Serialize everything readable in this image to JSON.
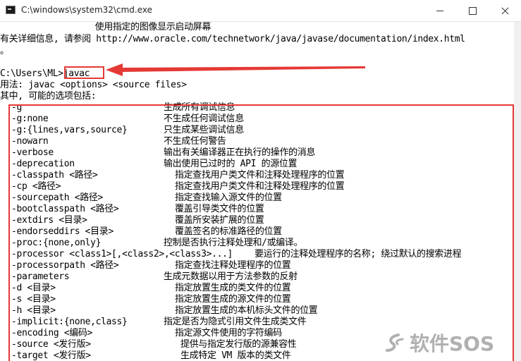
{
  "window": {
    "title": "C:\\windows\\system32\\cmd.exe"
  },
  "console": {
    "top_lines": [
      "                  使用指定的图像显示启动屏幕",
      "有关详细信息, 请参阅 http://www.oracle.com/technetwork/java/javase/documentation/index.html",
      "。"
    ],
    "prompt": "C:\\Users\\ML>",
    "command": "javac",
    "usage": "用法: javac <options> <source files>",
    "options_intro": "其中, 可能的选项包括:",
    "options": [
      {
        "name": "-g",
        "desc": "生成所有调试信息"
      },
      {
        "name": "-g:none",
        "desc": "不生成任何调试信息"
      },
      {
        "name": "-g:{lines,vars,source}",
        "desc": "只生成某些调试信息"
      },
      {
        "name": "-nowarn",
        "desc": "不生成任何警告"
      },
      {
        "name": "-verbose",
        "desc": "输出有关编译器正在执行的操作的消息"
      },
      {
        "name": "-deprecation",
        "desc": "输出使用已过时的 API 的源位置"
      },
      {
        "name": "-classpath <路径>",
        "desc": "指定查找用户类文件和注释处理程序的位置"
      },
      {
        "name": "-cp <路径>",
        "desc": "指定查找用户类文件和注释处理程序的位置"
      },
      {
        "name": "-sourcepath <路径>",
        "desc": "指定查找输入源文件的位置"
      },
      {
        "name": "-bootclasspath <路径>",
        "desc": "覆盖引导类文件的位置"
      },
      {
        "name": "-extdirs <目录>",
        "desc": "覆盖所安装扩展的位置"
      },
      {
        "name": "-endorseddirs <目录>",
        "desc": "覆盖签名的标准路径的位置"
      },
      {
        "name": "-proc:{none,only}",
        "desc": "控制是否执行注释处理和/或编译。"
      },
      {
        "name": "-processor <class1>[,<class2>,<class3>...]",
        "desc": "要运行的注释处理程序的名称; 绕过默认的搜索进程"
      },
      {
        "name": "-processorpath <路径>",
        "desc": "指定查找注释处理程序的位置"
      },
      {
        "name": "-parameters",
        "desc": "生成元数据以用于方法参数的反射"
      },
      {
        "name": "-d <目录>",
        "desc": "指定放置生成的类文件的位置"
      },
      {
        "name": "-s <目录>",
        "desc": "指定放置生成的源文件的位置"
      },
      {
        "name": "-h <目录>",
        "desc": "指定放置生成的本机标头文件的位置"
      },
      {
        "name": "-implicit:{none,class}",
        "desc": "指定是否为隐式引用文件生成类文件"
      },
      {
        "name": "-encoding <编码>",
        "desc": "指定源文件使用的字符编码"
      },
      {
        "name": "-source <发行版>",
        "desc": "提供与指定发行版的源兼容性"
      },
      {
        "name": "-target <发行版>",
        "desc": "生成特定 VM 版本的类文件"
      }
    ]
  },
  "annotation": {
    "color": "#e53935"
  },
  "watermark": {
    "text": "软件SOS"
  }
}
